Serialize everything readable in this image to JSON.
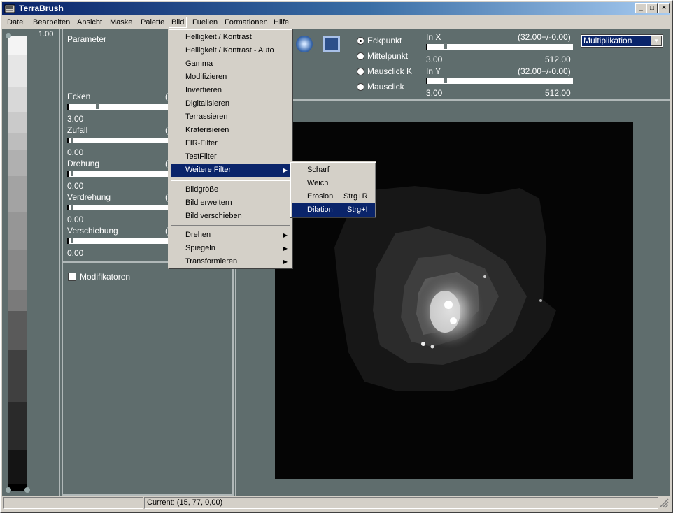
{
  "window": {
    "title": "TerraBrush",
    "app_icon": "terrabrush-icon"
  },
  "caption_buttons": {
    "minimize": "_",
    "maximize": "□",
    "close": "×"
  },
  "menubar": [
    {
      "label": "Datei"
    },
    {
      "label": "Bearbeiten"
    },
    {
      "label": "Ansicht"
    },
    {
      "label": "Maske"
    },
    {
      "label": "Palette"
    },
    {
      "label": "Bild"
    },
    {
      "label": "Fuellen"
    },
    {
      "label": "Formationen"
    },
    {
      "label": "Hilfe"
    }
  ],
  "palette": {
    "top_value": "1.00"
  },
  "parameters": {
    "title": "Parameter",
    "sliders": [
      {
        "label": "Ecken",
        "value": "3.00",
        "right_fragment": "(",
        "fraction": 0.28
      },
      {
        "label": "Zufall",
        "value": "0.00",
        "right_fragment": "(",
        "fraction": 0.02
      },
      {
        "label": "Drehung",
        "value": "0.00",
        "right_fragment": "(",
        "fraction": 0.02
      },
      {
        "label": "Verdrehung",
        "value": "0.00",
        "right_fragment": "(",
        "fraction": 0.02
      },
      {
        "label": "Verschiebung",
        "value": "0.00",
        "right_fragment": "(",
        "fraction": 0.02
      }
    ]
  },
  "modifiers": {
    "label": "Modifikatoren",
    "checked": false
  },
  "tools": {
    "circle_tool": "circle-brush-icon",
    "square_tool": "square-brush-icon"
  },
  "anchor_options": [
    {
      "label": "Eckpunkt",
      "selected": true
    },
    {
      "label": "Mittelpunkt",
      "selected": false
    },
    {
      "label": "Mausclick K",
      "selected": false
    },
    {
      "label": "Mausclick",
      "selected": false
    }
  ],
  "in_x": {
    "label": "In X",
    "value": "(32.00+/-0.00)",
    "min": "3.00",
    "max": "512.00",
    "fraction": 0.12
  },
  "in_y": {
    "label": "In Y",
    "value": "(32.00+/-0.00)",
    "min": "3.00",
    "max": "512.00",
    "fraction": 0.12
  },
  "blend_mode": {
    "selected": "Multiplikation"
  },
  "bild_menu": [
    {
      "label": "Helligkeit / Kontrast"
    },
    {
      "label": "Helligkeit / Kontrast - Auto"
    },
    {
      "label": "Gamma"
    },
    {
      "label": "Modifizieren"
    },
    {
      "label": "Invertieren"
    },
    {
      "label": "Digitalisieren"
    },
    {
      "label": "Terrassieren"
    },
    {
      "label": "Kraterisieren"
    },
    {
      "label": "FIR-Filter"
    },
    {
      "label": "TestFilter"
    },
    {
      "label": "Weitere Filter",
      "submenu": true,
      "highlighted": true
    },
    {
      "label": "Bildgröße"
    },
    {
      "label": "Bild erweitern"
    },
    {
      "label": "Bild verschieben"
    },
    {
      "label": "Drehen",
      "submenu": true
    },
    {
      "label": "Spiegeln",
      "submenu": true
    },
    {
      "label": "Transformieren",
      "submenu": true
    }
  ],
  "filter_submenu": [
    {
      "label": "Scharf",
      "shortcut": ""
    },
    {
      "label": "Weich",
      "shortcut": ""
    },
    {
      "label": "Erosion",
      "shortcut": "Strg+R"
    },
    {
      "label": "Dilation",
      "shortcut": "Strg+I",
      "highlighted": true
    }
  ],
  "statusbar": {
    "left": "",
    "current": "Current: (15, 77, 0,00)"
  }
}
